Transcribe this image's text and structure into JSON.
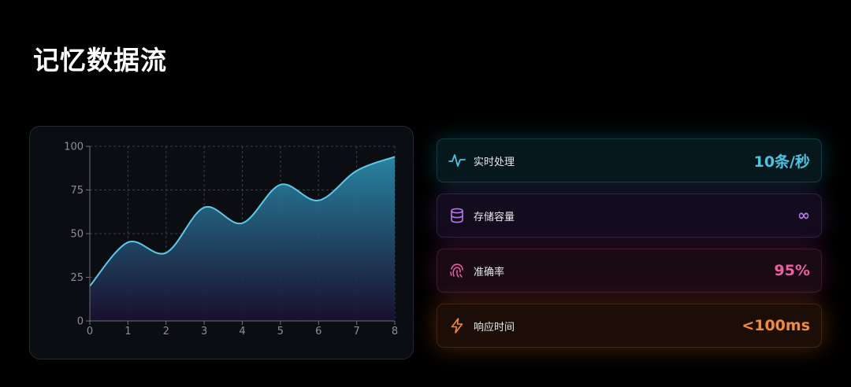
{
  "page": {
    "title": "记忆数据流"
  },
  "chart_data": {
    "type": "area",
    "x": [
      0,
      1,
      2,
      3,
      4,
      5,
      6,
      7,
      8
    ],
    "values": [
      20,
      45,
      39,
      65,
      56,
      78,
      69,
      86,
      94
    ],
    "xlim": [
      0,
      8
    ],
    "ylim": [
      0,
      100
    ],
    "xticks": [
      0,
      1,
      2,
      3,
      4,
      5,
      6,
      7,
      8
    ],
    "yticks": [
      0,
      25,
      50,
      75,
      100
    ],
    "grid": true,
    "line_color": "#5ec9ea",
    "fill_top_color": "#2a8aa8",
    "fill_bottom_color": "#1a1030"
  },
  "metrics": [
    {
      "label": "实时处理",
      "value": "10条/秒",
      "icon": "pulse-icon",
      "color": "#4cc3e0"
    },
    {
      "label": "存储容量",
      "value": "∞",
      "icon": "database-icon",
      "color": "#b57be8"
    },
    {
      "label": "准确率",
      "value": "95%",
      "icon": "fingerprint-icon",
      "color": "#ec5fa3"
    },
    {
      "label": "响应时间",
      "value": "<100ms",
      "icon": "lightning-icon",
      "color": "#f38a3b"
    }
  ]
}
